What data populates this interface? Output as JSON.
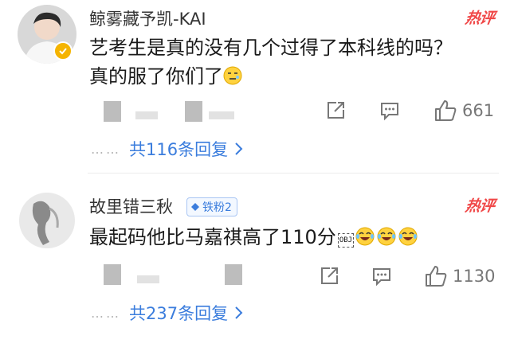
{
  "comments": [
    {
      "username": "鲸雾藏予凯-KAI",
      "hot_label": "热评",
      "verified": true,
      "text_line1": "艺考生是真的没有几个过得了本科线的吗？",
      "text_line2": "真的服了你们了",
      "emoji_icon": "smirk-emoji-icon",
      "likes": "661",
      "reply_summary": "共116条回复"
    },
    {
      "username": "故里错三秋",
      "fans_badge": "铁粉2",
      "hot_label": "热评",
      "text": "最起码他比马嘉祺高了110分",
      "obj_label": "OBJ",
      "emoji_icon": "laughing-tears-emoji-icon",
      "emoji_count": 3,
      "likes": "1130",
      "reply_summary": "共237条回复"
    }
  ],
  "colors": {
    "link_blue": "#3b7ddd",
    "hot_red": "#f04848",
    "verified_gold": "#f5b400"
  }
}
